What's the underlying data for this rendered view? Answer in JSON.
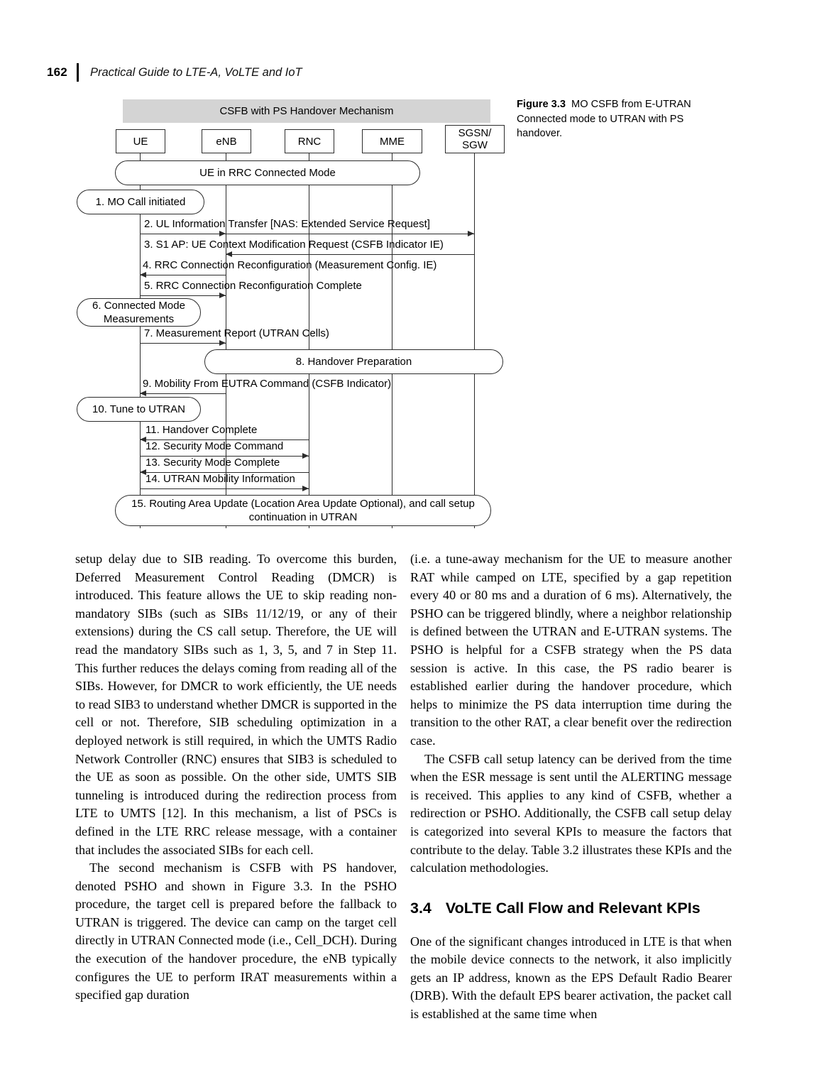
{
  "page": {
    "folio": "162",
    "running_title": "Practical Guide to LTE-A, VoLTE and IoT"
  },
  "figure": {
    "caption_number": "Figure 3.3",
    "caption_text": "MO CSFB from E-UTRAN Connected mode to UTRAN with PS handover.",
    "title_band": "CSFB with PS Handover Mechanism",
    "actors": [
      {
        "label": "UE"
      },
      {
        "label": "eNB"
      },
      {
        "label": "RNC"
      },
      {
        "label": "MME"
      },
      {
        "label": "SGSN/\nSGW"
      }
    ],
    "actor_sgsn_line1": "SGSN/",
    "actor_sgsn_line2": "SGW",
    "bands": {
      "rrc_connected": "UE in RRC Connected Mode",
      "handover_prep": "8. Handover Preparation",
      "final_line1": "15. Routing Area Update (Location Area Update Optional), and call setup",
      "final_line2": "continuation in UTRAN"
    },
    "side_boxes": {
      "step1": "1. MO Call initiated",
      "step6_line1": "6. Connected Mode",
      "step6_line2": "Measurements",
      "step10": "10. Tune to UTRAN"
    },
    "messages": [
      {
        "label": "2. UL Information Transfer [NAS: Extended Service Request]"
      },
      {
        "label": "3. S1 AP: UE Context Modification Request (CSFB Indicator IE)"
      },
      {
        "label": "4. RRC Connection Reconfiguration (Measurement Config. IE)"
      },
      {
        "label": "5. RRC Connection Reconfiguration Complete"
      },
      {
        "label": "7. Measurement Report (UTRAN Cells)"
      },
      {
        "label": "9. Mobility From EUTRA Command (CSFB Indicator)"
      },
      {
        "label": "11. Handover Complete"
      },
      {
        "label": "12. Security Mode Command"
      },
      {
        "label": "13. Security Mode Complete"
      },
      {
        "label": "14. UTRAN Mobility Information"
      }
    ]
  },
  "body": {
    "left_col": {
      "p1": "setup delay due to SIB reading. To overcome this burden, Deferred Measurement Control Reading (DMCR) is introduced. This feature allows the UE to skip reading non-mandatory SIBs (such as SIBs 11/12/19, or any of their extensions) during the CS call setup. Therefore, the UE will read the mandatory SIBs such as 1, 3, 5, and 7 in Step 11. This further reduces the delays coming from reading all of the SIBs. However, for DMCR to work efficiently, the UE needs to read SIB3 to understand whether DMCR is supported in the cell or not. Therefore, SIB scheduling optimization in a deployed network is still required, in which the UMTS Radio Network Controller (RNC) ensures that SIB3 is scheduled to the UE as soon as possible. On the other side, UMTS SIB tunneling is introduced during the redirection process from LTE to UMTS [12]. In this mechanism, a list of PSCs is defined in the LTE RRC release message, with a container that includes the associated SIBs for each cell.",
      "p2": "The second mechanism is CSFB with PS handover, denoted PSHO and shown in Figure 3.3. In the PSHO procedure, the target cell is prepared before the fallback to UTRAN is triggered. The device can camp on the target cell directly in UTRAN Connected mode (i.e., Cell_DCH). During the execution of the handover procedure, the eNB typically configures the UE to perform IRAT measurements within a specified gap duration"
    },
    "right_col": {
      "p1": "(i.e. a tune-away mechanism for the UE to measure another RAT while camped on LTE, specified by a gap repetition every 40 or 80 ms and a duration of 6 ms). Alternatively, the PSHO can be triggered blindly, where a neighbor relationship is defined between the UTRAN and E-UTRAN systems. The PSHO is helpful for a CSFB strategy when the PS data session is active. In this case, the PS radio bearer is established earlier during the handover procedure, which helps to minimize the PS data interruption time during the transition to the other RAT, a clear benefit over the redirection case.",
      "p2": "The CSFB call setup latency can be derived from the time when the ESR message is sent until the ALERTING message is received. This applies to any kind of CSFB, whether a redirection or PSHO. Additionally, the CSFB call setup delay is categorized into several KPIs to measure the factors that contribute to the delay. Table 3.2 illustrates these KPIs and the calculation methodologies.",
      "section_number": "3.4",
      "section_title": "VoLTE Call Flow and Relevant KPIs",
      "p3": "One of the significant changes introduced in LTE is that when the mobile device connects to the network, it also implicitly gets an IP address, known as the EPS Default Radio Bearer (DRB). With the default EPS bearer activation, the packet call is established at the same time when"
    }
  },
  "colors": {
    "band_fill": "#d4d4d4",
    "line": "#2b2b2b",
    "text": "#000000"
  }
}
